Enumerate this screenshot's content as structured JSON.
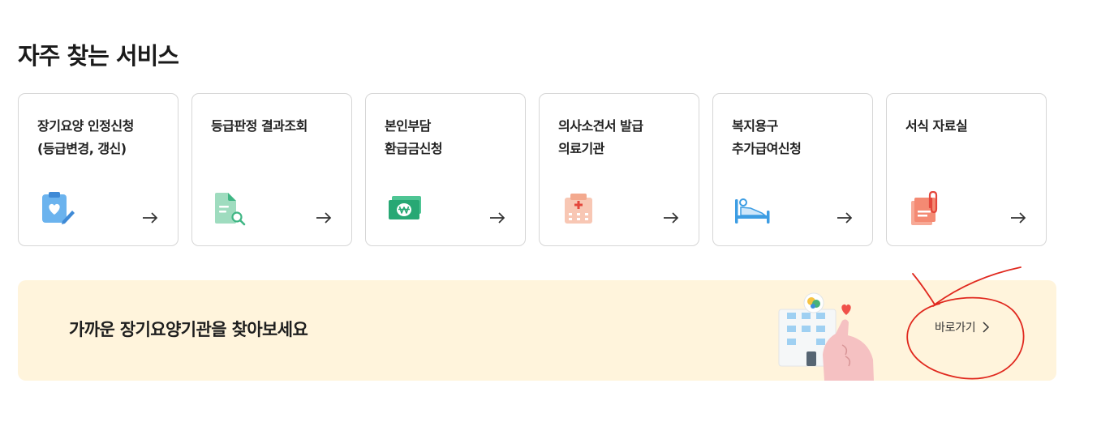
{
  "section": {
    "title": "자주 찾는 서비스"
  },
  "cards": [
    {
      "title": "장기요양 인정신청\n(등급변경, 갱신)",
      "icon": "clipboard-heart-icon"
    },
    {
      "title": "등급판정 결과조회",
      "icon": "document-search-icon"
    },
    {
      "title": "본인부담\n환급금신청",
      "icon": "won-banknote-icon"
    },
    {
      "title": "의사소견서 발급\n의료기관",
      "icon": "hospital-icon"
    },
    {
      "title": "복지용구\n추가급여신청",
      "icon": "hospital-bed-icon"
    },
    {
      "title": "서식 자료실",
      "icon": "clipped-documents-icon"
    }
  ],
  "banner": {
    "text": "가까운 장기요양기관을 찾아보세요",
    "link_label": "바로가기"
  },
  "colors": {
    "banner_bg": "#fff4dc",
    "annotation": "#e0281e"
  }
}
